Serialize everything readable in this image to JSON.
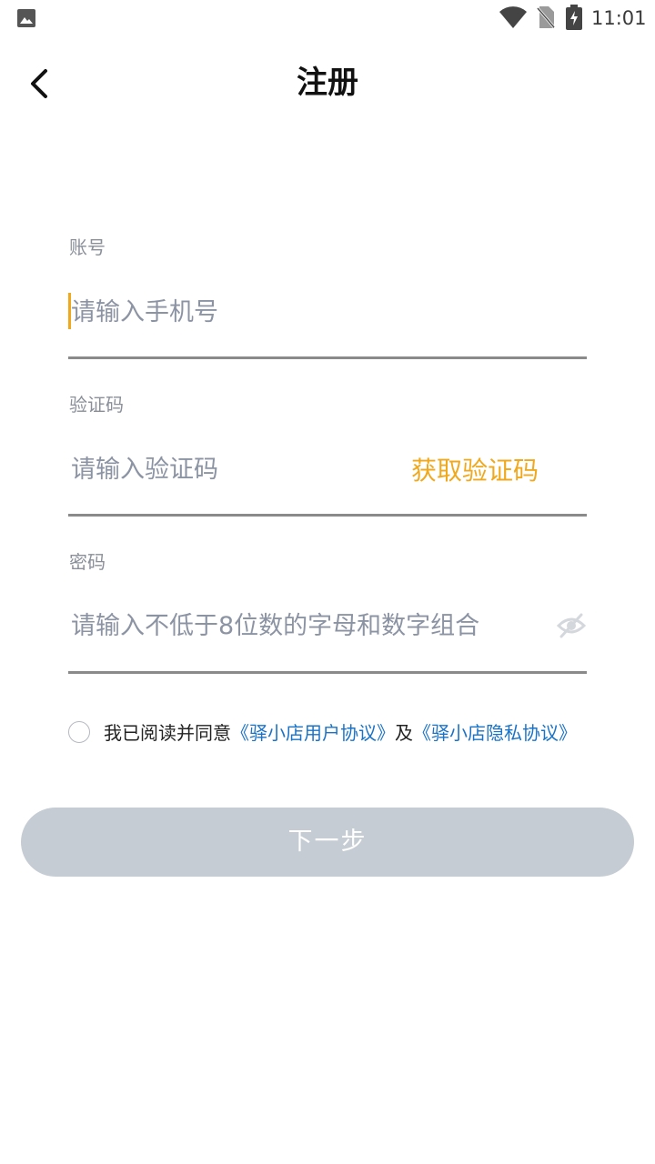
{
  "status_bar": {
    "time": "11:01",
    "icons": [
      "image-icon",
      "wifi-icon",
      "no-sim-icon",
      "battery-charging-icon"
    ]
  },
  "header": {
    "back_icon": "chevron-left-icon",
    "title": "注册"
  },
  "form": {
    "account": {
      "label": "账号",
      "placeholder": "请输入手机号",
      "value": ""
    },
    "code": {
      "label": "验证码",
      "placeholder": "请输入验证码",
      "value": "",
      "get_code_label": "获取验证码"
    },
    "password": {
      "label": "密码",
      "placeholder": "请输入不低于8位数的字母和数字组合",
      "value": "",
      "toggle_icon": "eye-off-icon"
    }
  },
  "agreement": {
    "checked": false,
    "prefix": "我已阅读并同意",
    "user_agreement": "《驿小店用户协议》",
    "connector": "及",
    "privacy_agreement": "《驿小店隐私协议》"
  },
  "next_button": {
    "label": "下一步"
  },
  "colors": {
    "accent": "#f0a81c",
    "link": "#1a73c8",
    "button_disabled": "#c5ccd3",
    "label": "#8a8f99"
  }
}
